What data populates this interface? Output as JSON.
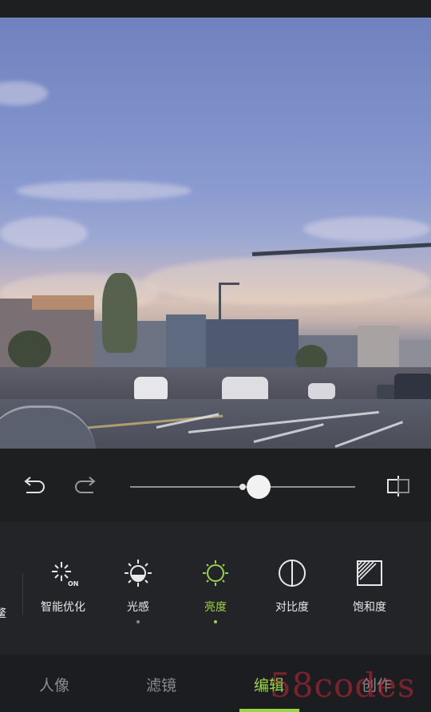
{
  "controls": {
    "undo_icon": "undo-arrow",
    "redo_icon": "redo-arrow",
    "compare_icon": "compare-split",
    "slider_value": 0.57
  },
  "tools": {
    "partial_label": "鳌",
    "items": [
      {
        "label": "智能优化",
        "icon": "sparkle-on",
        "active": false,
        "dot": false
      },
      {
        "label": "光感",
        "icon": "sun-half",
        "active": false,
        "dot": true
      },
      {
        "label": "亮度",
        "icon": "sun",
        "active": true,
        "dot": true
      },
      {
        "label": "对比度",
        "icon": "contrast-circle",
        "active": false,
        "dot": false
      },
      {
        "label": "饱和度",
        "icon": "saturation-square",
        "active": false,
        "dot": false
      }
    ]
  },
  "tabs": [
    "人像",
    "滤镜",
    "编辑",
    "创作"
  ],
  "active_tab": "编辑",
  "watermark": "58codes",
  "colors": {
    "accent": "#9bd34a",
    "background": "#1e1f21",
    "panel": "#232427"
  }
}
